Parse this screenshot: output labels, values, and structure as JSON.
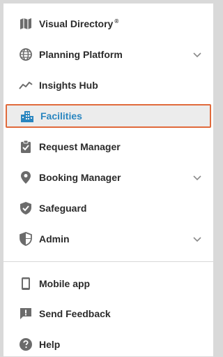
{
  "nav": {
    "items": [
      {
        "label": "Visual Directory",
        "mark": "®",
        "icon": "map-icon"
      },
      {
        "label": "Planning Platform",
        "icon": "globe-icon",
        "expandable": true
      },
      {
        "label": "Insights Hub",
        "icon": "trend-line-icon"
      },
      {
        "label": "Facilities",
        "icon": "buildings-icon",
        "active": true
      },
      {
        "label": "Request Manager",
        "icon": "clipboard-check-icon"
      },
      {
        "label": "Booking Manager",
        "icon": "location-pin-icon",
        "expandable": true
      },
      {
        "label": "Safeguard",
        "icon": "shield-check-icon"
      },
      {
        "label": "Admin",
        "icon": "shield-half-icon",
        "expandable": true
      }
    ],
    "secondary": [
      {
        "label": "Mobile app",
        "icon": "mobile-phone-icon"
      },
      {
        "label": "Send Feedback",
        "icon": "feedback-icon"
      },
      {
        "label": "Help",
        "icon": "help-icon"
      }
    ]
  },
  "colors": {
    "active_text": "#2a86c0",
    "active_border": "#e06a3b",
    "active_bg": "#ececec",
    "icon": "#6b6b6b"
  }
}
